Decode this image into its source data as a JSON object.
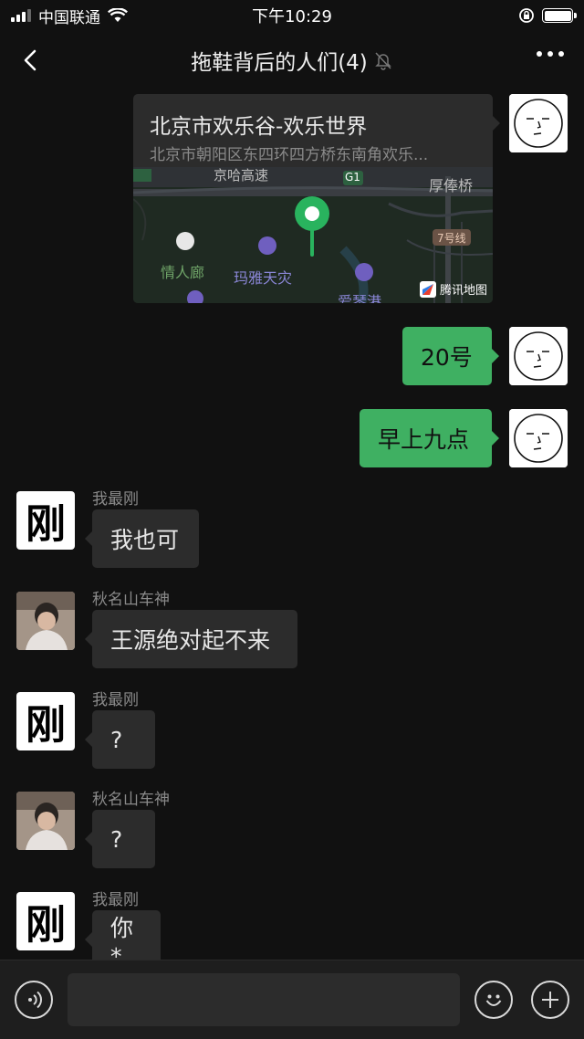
{
  "status_bar": {
    "carrier": "中国联通",
    "time": "下午10:29",
    "battery_level": 1.0,
    "signal_bars": 3
  },
  "nav": {
    "title": "拖鞋背后的人们(4)",
    "muted": true
  },
  "location_message": {
    "title": "北京市欢乐谷-欢乐世界",
    "address": "北京市朝阳区东四环四方桥东南角欢乐...",
    "map_labels": {
      "expressway": "京哈高速",
      "g1": "G1",
      "bridge": "厚俸桥",
      "subway": "7号线",
      "poi1": "情人廊",
      "poi2": "玛雅天灾",
      "poi3": "爱琴港",
      "brand": "腾讯地图"
    }
  },
  "messages": [
    {
      "sender": "",
      "text": "20号",
      "side": "right"
    },
    {
      "sender": "",
      "text": "早上九点",
      "side": "right"
    },
    {
      "sender": "我最刚",
      "avatar_char": "刚",
      "text": "我也可",
      "side": "left"
    },
    {
      "sender": "秋名山车神",
      "text": "王源绝对起不来",
      "side": "left"
    },
    {
      "sender": "我最刚",
      "avatar_char": "刚",
      "text": "?",
      "side": "left"
    },
    {
      "sender": "秋名山车神",
      "text": "?",
      "side": "left"
    },
    {
      "sender": "我最刚",
      "avatar_char": "刚",
      "text": "你*",
      "side": "left"
    }
  ],
  "input": {
    "value": "",
    "placeholder": ""
  },
  "colors": {
    "background": "#111111",
    "my_bubble": "#3fb062",
    "other_bubble": "#2c2c2c"
  },
  "icons": [
    "back-icon",
    "mute-bell-icon",
    "more-icon",
    "voice-icon",
    "emoji-icon",
    "plus-icon",
    "map-pin-icon"
  ]
}
